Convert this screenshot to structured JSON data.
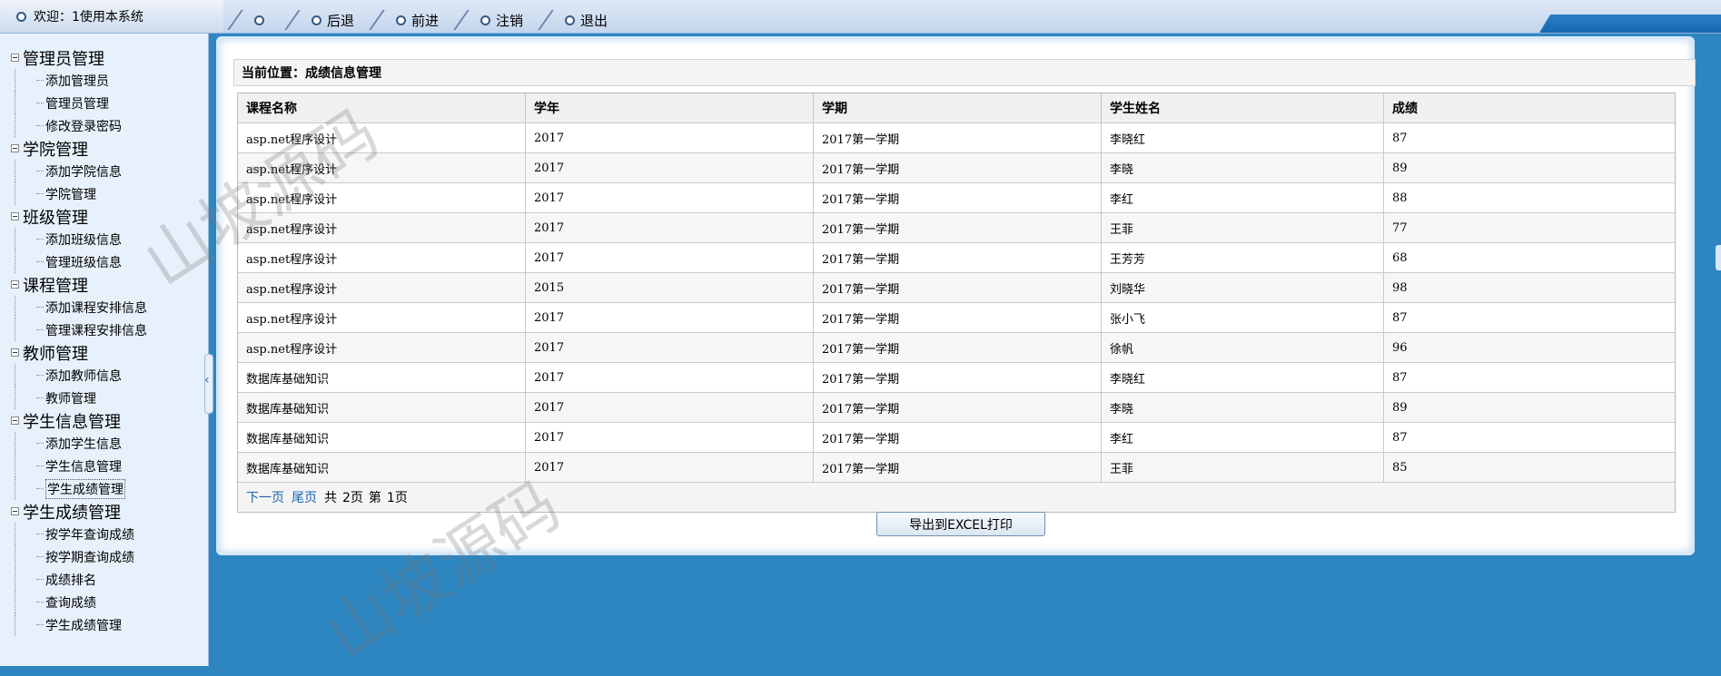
{
  "topbar": {
    "welcome": "欢迎：1使用本系统",
    "nav": [
      "",
      "后退",
      "前进",
      "注销",
      "退出"
    ]
  },
  "sidebar": {
    "groups": [
      {
        "label": "管理员管理",
        "items": [
          "添加管理员",
          "管理员管理",
          "修改登录密码"
        ]
      },
      {
        "label": "学院管理",
        "items": [
          "添加学院信息",
          "学院管理"
        ]
      },
      {
        "label": "班级管理",
        "items": [
          "添加班级信息",
          "管理班级信息"
        ]
      },
      {
        "label": "课程管理",
        "items": [
          "添加课程安排信息",
          "管理课程安排信息"
        ]
      },
      {
        "label": "教师管理",
        "items": [
          "添加教师信息",
          "教师管理"
        ]
      },
      {
        "label": "学生信息管理",
        "items": [
          "添加学生信息",
          "学生信息管理",
          "学生成绩管理"
        ]
      },
      {
        "label": "学生成绩管理",
        "items": [
          "按学年查询成绩",
          "按学期查询成绩",
          "成绩排名",
          "查询成绩",
          "学生成绩管理"
        ]
      }
    ]
  },
  "main": {
    "location": "当前位置：成绩信息管理",
    "columns": [
      "课程名称",
      "学年",
      "学期",
      "学生姓名",
      "成绩"
    ],
    "rows": [
      [
        "asp.net程序设计",
        "2017",
        "2017第一学期",
        "李晓红",
        "87"
      ],
      [
        "asp.net程序设计",
        "2017",
        "2017第一学期",
        "李晓",
        "89"
      ],
      [
        "asp.net程序设计",
        "2017",
        "2017第一学期",
        "李红",
        "88"
      ],
      [
        "asp.net程序设计",
        "2017",
        "2017第一学期",
        "王菲",
        "77"
      ],
      [
        "asp.net程序设计",
        "2017",
        "2017第一学期",
        "王芳芳",
        "68"
      ],
      [
        "asp.net程序设计",
        "2015",
        "2017第一学期",
        "刘晓华",
        "98"
      ],
      [
        "asp.net程序设计",
        "2017",
        "2017第一学期",
        "张小飞",
        "87"
      ],
      [
        "asp.net程序设计",
        "2017",
        "2017第一学期",
        "徐帆",
        "96"
      ],
      [
        "数据库基础知识",
        "2017",
        "2017第一学期",
        "李晓红",
        "87"
      ],
      [
        "数据库基础知识",
        "2017",
        "2017第一学期",
        "李晓",
        "89"
      ],
      [
        "数据库基础知识",
        "2017",
        "2017第一学期",
        "李红",
        "87"
      ],
      [
        "数据库基础知识",
        "2017",
        "2017第一学期",
        "王菲",
        "85"
      ]
    ],
    "pager": {
      "next": "下一页",
      "last": "尾页",
      "total_prefix": "共",
      "total": "2页",
      "current_prefix": "第",
      "current": "1页"
    },
    "export_label": "导出到EXCEL打印"
  },
  "watermark": "山坡源码"
}
